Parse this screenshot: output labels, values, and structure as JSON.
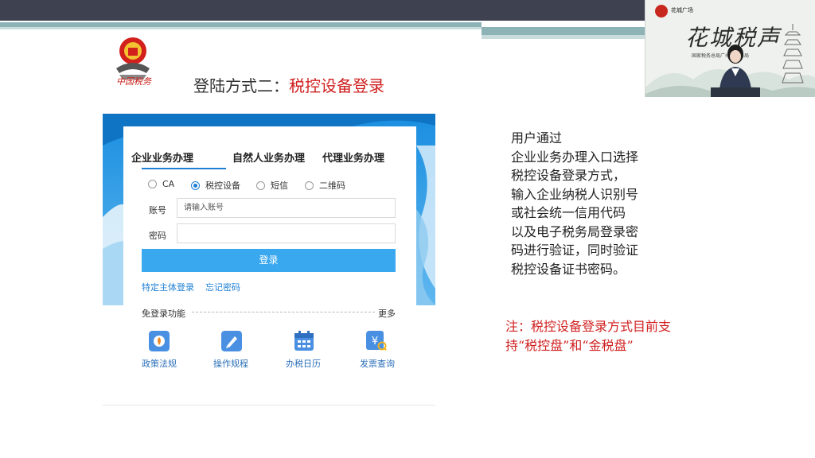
{
  "slide": {
    "logo_text": "中国税务",
    "title_prefix": "登陆方式二：",
    "title_highlight": "税控设备登录"
  },
  "inset": {
    "channel": "花城广场",
    "brand": "花城税声",
    "tagline": "国家税务总局广州市税务局"
  },
  "login": {
    "tabs": [
      "企业业务办理",
      "自然人业务办理",
      "代理业务办理"
    ],
    "active_tab_index": 0,
    "radios": [
      "CA",
      "税控设备",
      "短信",
      "二维码"
    ],
    "selected_radio": "税控设备",
    "account_label": "账号",
    "account_placeholder": "请输入账号",
    "password_label": "密码",
    "password_value": "",
    "login_button": "登录",
    "links": [
      "特定主体登录",
      "忘记密码"
    ],
    "free_label": "免登录功能",
    "more": "更多",
    "quick_items": [
      "政策法规",
      "操作规程",
      "办税日历",
      "发票查询"
    ],
    "quick_icons": [
      "policy-icon",
      "procedure-icon",
      "calendar-icon",
      "invoice-query-icon"
    ]
  },
  "note": {
    "lines": [
      "用户通过",
      "企业业务办理入口选择",
      "税控设备登录方式，",
      "输入企业纳税人识别号",
      "或社会统一信用代码",
      "以及电子税务局登录密",
      "码进行验证，同时验证",
      "税控设备证书密码。"
    ]
  },
  "red_note": {
    "text": "注：税控设备登录方式目前支持“税控盘”和“金税盘”"
  },
  "colors": {
    "accent_blue": "#1e7fd4",
    "button_blue": "#39a8ef",
    "highlight_red": "#d01f1f"
  }
}
